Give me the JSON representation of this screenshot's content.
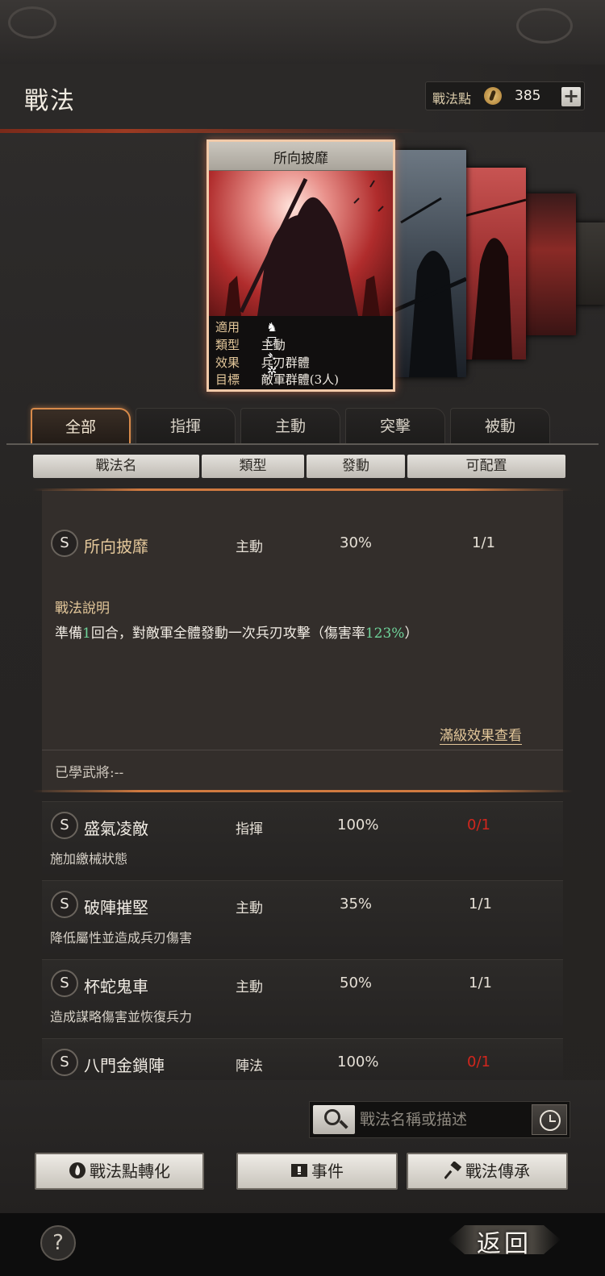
{
  "header": {
    "title": "戰法",
    "points_label": "戰法點",
    "points_value": "385",
    "plus_label": "+"
  },
  "featured_card": {
    "name": "所向披靡",
    "rows": [
      {
        "key": "適用",
        "value": ""
      },
      {
        "key": "類型",
        "value": "主動"
      },
      {
        "key": "效果",
        "value": "兵刃群體"
      },
      {
        "key": "目標",
        "value": "敵軍群體(3人)"
      }
    ],
    "unit_icons": [
      "cavalry-icon",
      "shield-icon",
      "archer-icon",
      "wheel-icon"
    ]
  },
  "tabs": [
    {
      "label": "全部",
      "active": true
    },
    {
      "label": "指揮",
      "active": false
    },
    {
      "label": "主動",
      "active": false
    },
    {
      "label": "突擊",
      "active": false
    },
    {
      "label": "被動",
      "active": false
    }
  ],
  "columns": [
    "戰法名",
    "類型",
    "發動",
    "可配置"
  ],
  "expanded": {
    "badge": "S",
    "name": "所向披靡",
    "type": "主動",
    "rate": "30%",
    "slot": "1/1",
    "desc_title": "戰法說明",
    "desc_parts": [
      "準備",
      "1",
      "回合，對敵軍全體發動一次兵刃攻擊（傷害率",
      "123%",
      "）"
    ],
    "full_link": "滿級效果查看",
    "learned": "已學武將:--"
  },
  "rows": [
    {
      "badge": "S",
      "name": "盛氣凌敵",
      "type": "指揮",
      "rate": "100%",
      "slot": "0/1",
      "slot_full": false,
      "desc": "施加繳械狀態"
    },
    {
      "badge": "S",
      "name": "破陣摧堅",
      "type": "主動",
      "rate": "35%",
      "slot": "1/1",
      "slot_full": true,
      "desc": "降低屬性並造成兵刃傷害"
    },
    {
      "badge": "S",
      "name": "杯蛇鬼車",
      "type": "主動",
      "rate": "50%",
      "slot": "1/1",
      "slot_full": true,
      "desc": "造成謀略傷害並恢復兵力"
    },
    {
      "badge": "S",
      "name": "八門金鎖陣",
      "type": "陣法",
      "rate": "100%",
      "slot": "0/1",
      "slot_full": false,
      "desc": ""
    }
  ],
  "search": {
    "placeholder": "戰法名稱或描述"
  },
  "actions": {
    "convert": "戰法點轉化",
    "event": "事件",
    "inherit": "戰法傳承"
  },
  "footer": {
    "help": "?",
    "back": "返回"
  },
  "colors": {
    "accent_orange": "#d88a4a",
    "gold_text": "#e3c79a",
    "highlight_green": "#6fd39a",
    "alert_red": "#d2261d"
  }
}
